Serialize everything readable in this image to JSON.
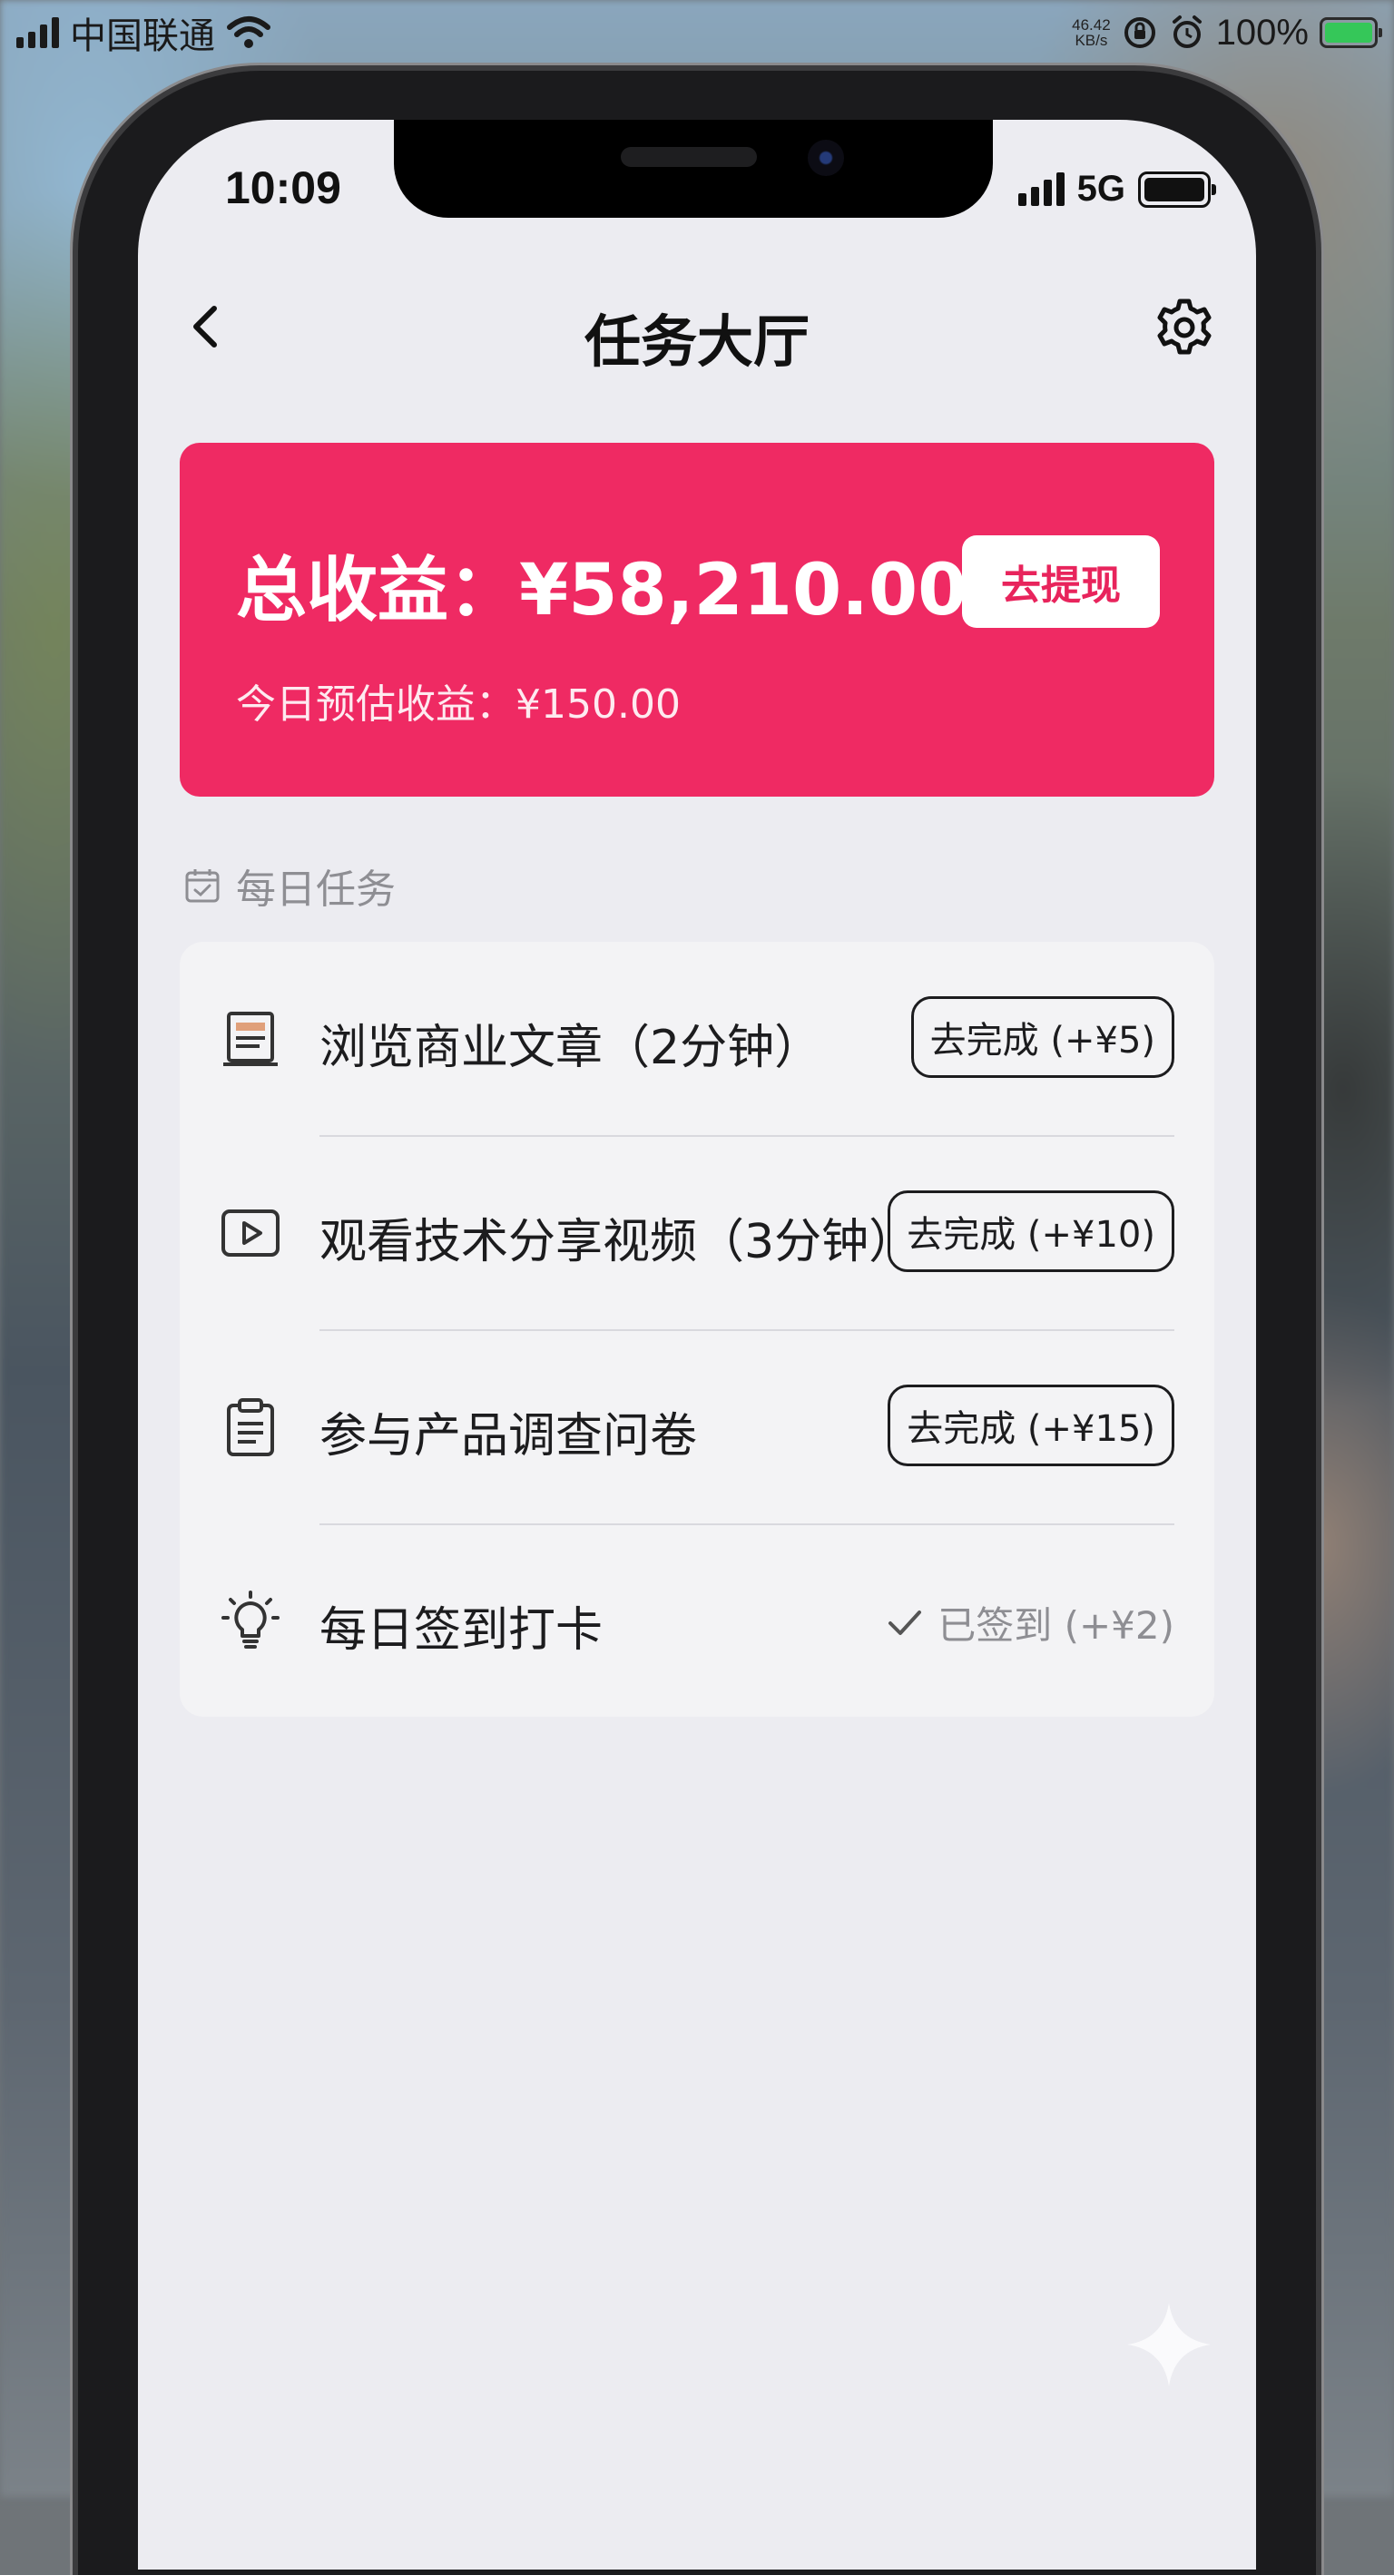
{
  "outer_status": {
    "carrier": "中国联通",
    "speed_top": "46.42",
    "speed_bottom": "KB/s",
    "battery_percent": "100%"
  },
  "inner_status": {
    "time": "10:09",
    "network": "5G"
  },
  "header": {
    "title": "任务大厅",
    "back_icon": "chevron-left-icon",
    "settings_icon": "gear-icon"
  },
  "earnings": {
    "total": "总收益：¥58,210.00",
    "withdraw_label": "去提现",
    "today": "今日预估收益：¥150.00",
    "card_color": "#ef2a63"
  },
  "daily_section": {
    "title": "每日任务",
    "icon": "calendar-check-icon"
  },
  "tasks": [
    {
      "label": "浏览商业文章（2分钟）",
      "button": "去完成 (+¥5)",
      "icon": "document-icon"
    },
    {
      "label": "观看技术分享视频（3分钟）",
      "button": "去完成 (+¥10)",
      "icon": "play-video-icon"
    },
    {
      "label": "参与产品调查问卷",
      "button": "去完成 (+¥15)",
      "icon": "clipboard-icon"
    },
    {
      "label": "每日签到打卡",
      "status": "已签到 (+¥2)",
      "icon": "lightbulb-icon"
    }
  ]
}
